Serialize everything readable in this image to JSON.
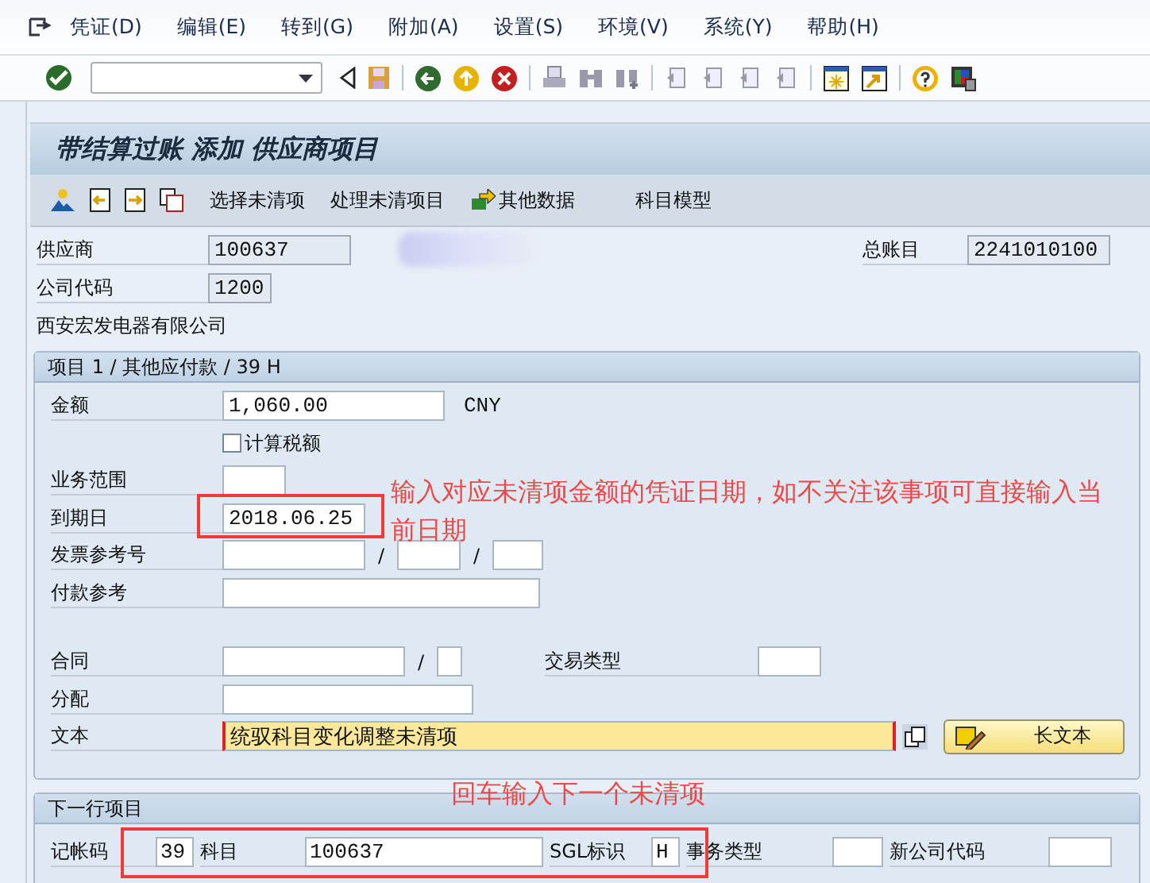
{
  "menu_bar": {
    "items": [
      "凭证(D)",
      "编辑(E)",
      "转到(G)",
      "附加(A)",
      "设置(S)",
      "环境(V)",
      "系统(Y)",
      "帮助(H)"
    ]
  },
  "title": "带结算过账 添加 供应商项目",
  "app_toolbar": {
    "buttons": [
      "选择未清项",
      "处理未清项目",
      "其他数据",
      "科目模型"
    ]
  },
  "header": {
    "vendor": {
      "label": "供应商",
      "value": "100637"
    },
    "gl_account": {
      "label": "总账目",
      "value": "2241010100"
    },
    "company_code": {
      "label": "公司代码",
      "value": "1200"
    },
    "vendor_name": "西安宏发电器有限公司"
  },
  "item": {
    "title": "项目 1 / 其他应付款 / 39 H",
    "amount": {
      "label": "金额",
      "value": "1,060.00",
      "currency": "CNY"
    },
    "calc_tax": {
      "label": "计算税额",
      "checked": false
    },
    "business_area": {
      "label": "业务范围"
    },
    "due_date": {
      "label": "到期日",
      "value": "2018.06.25"
    },
    "invoice_ref": {
      "label": "发票参考号",
      "separators": [
        "/",
        "/"
      ]
    },
    "payment_ref": {
      "label": "付款参考"
    },
    "contract": {
      "label": "合同",
      "separator": "/"
    },
    "transaction_type": {
      "label": "交易类型"
    },
    "assignment": {
      "label": "分配"
    },
    "text": {
      "label": "文本",
      "value": "统驭科目变化调整未清项"
    },
    "long_text_button": "长文本"
  },
  "next_line": {
    "title": "下一行项目",
    "fields": [
      {
        "label": "记帐码",
        "value": "39"
      },
      {
        "label": "科目",
        "value": "100637"
      },
      {
        "label": "SGL标识",
        "value": "H"
      },
      {
        "label": "事务类型"
      },
      {
        "label": "新公司代码"
      }
    ]
  },
  "annotations": [
    {
      "text": "输入对应未清项金额的凭证日期，如不关注该事项可直接输入当前日期"
    },
    {
      "text": "回车输入下一个未清项"
    }
  ]
}
